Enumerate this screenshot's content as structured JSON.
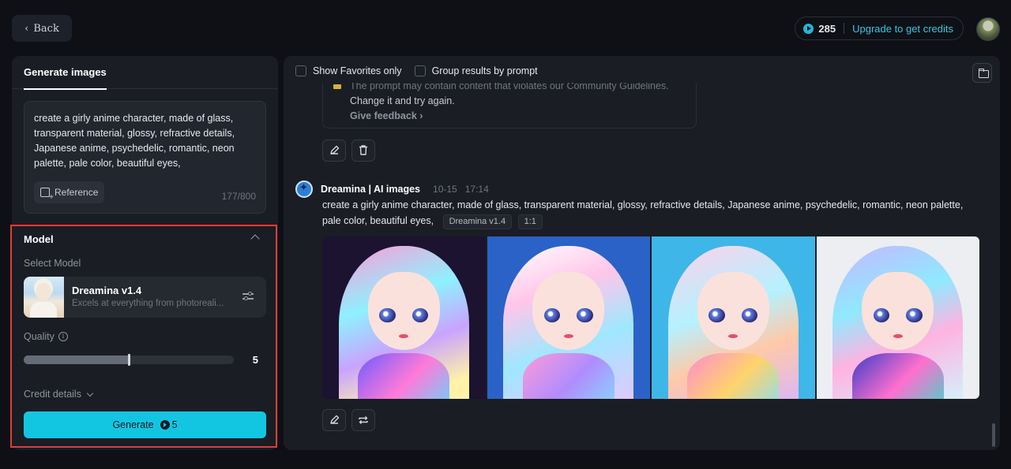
{
  "header": {
    "back_label": "Back",
    "credits": "285",
    "upgrade_label": "Upgrade to get credits"
  },
  "left_panel": {
    "tab_label": "Generate images",
    "prompt_text": "create a girly anime character, made of glass, transparent material, glossy, refractive details, Japanese anime, psychedelic, romantic, neon palette, pale color, beautiful eyes,",
    "reference_label": "Reference",
    "char_count": "177/800",
    "model_section": {
      "title": "Model",
      "select_label": "Select Model",
      "model_name": "Dreamina v1.4",
      "model_desc": "Excels at everything from photoreali...",
      "quality_label": "Quality",
      "quality_value": "5",
      "quality_fraction": 0.5,
      "credit_details_label": "Credit details",
      "generate_label": "Generate",
      "generate_cost": "5"
    }
  },
  "right_panel": {
    "filters": {
      "favorites_label": "Show Favorites only",
      "group_label": "Group results by prompt"
    },
    "warning": {
      "line1": "The prompt may contain content that violates our Community Guidelines.",
      "line2": "Change it and try again.",
      "feedback_label": "Give feedback"
    },
    "message": {
      "author": "Dreamina | AI images",
      "date": "10-15",
      "time": "17:14",
      "prompt": "create a girly anime character, made of glass, transparent material, glossy, refractive details, Japanese anime, psychedelic, romantic, neon palette, pale color, beautiful eyes,",
      "model_tag": "Dreamina v1.4",
      "ratio_tag": "1:1"
    },
    "images": [
      {
        "name": "generated-image-1",
        "bg": "#1b1330",
        "hair": "linear-gradient(160deg,#ff9ad5,#8ff0ff 35%,#c9a3ff 60%,#fff2a8 85%)",
        "body": "linear-gradient(135deg,#6a5cff,#ff7ad9,#54e0ff)"
      },
      {
        "name": "generated-image-2",
        "bg": "#2a62c8",
        "hair": "linear-gradient(160deg,#ffffff,#ffc6ea 30%,#9fe7ff 60%,#e6c6ff)",
        "body": "linear-gradient(135deg,#ff9bd6,#b08cff,#7fe3ff)"
      },
      {
        "name": "generated-image-3",
        "bg": "#3fb6e8",
        "hair": "linear-gradient(160deg,#ffd1ec,#b5f1ff 40%,#ffc9a8 65%,#d7b5ff)",
        "body": "linear-gradient(135deg,#ff8ccf,#ffd36b,#7ee0ff)"
      },
      {
        "name": "generated-image-4",
        "bg": "#eceef2",
        "hair": "linear-gradient(160deg,#c7b6ff,#8fe9ff 35%,#ffb3e1 60%,#d0f7ff)",
        "body": "linear-gradient(135deg,#3a3cc8,#ff6fcf,#2fe0c8)"
      }
    ]
  },
  "colors": {
    "accent": "#12c6e2",
    "highlight_border": "#e23b3b",
    "background": "#0e1015",
    "panel": "#1a1d24"
  },
  "icons": [
    "chevron-left-icon",
    "credit-coin-icon",
    "reference-icon",
    "chevron-up-icon",
    "model-settings-icon",
    "info-icon",
    "chevron-down-icon",
    "folder-icon",
    "edit-icon",
    "trash-icon",
    "regenerate-icon",
    "dreamina-bot-icon",
    "warning-icon"
  ]
}
